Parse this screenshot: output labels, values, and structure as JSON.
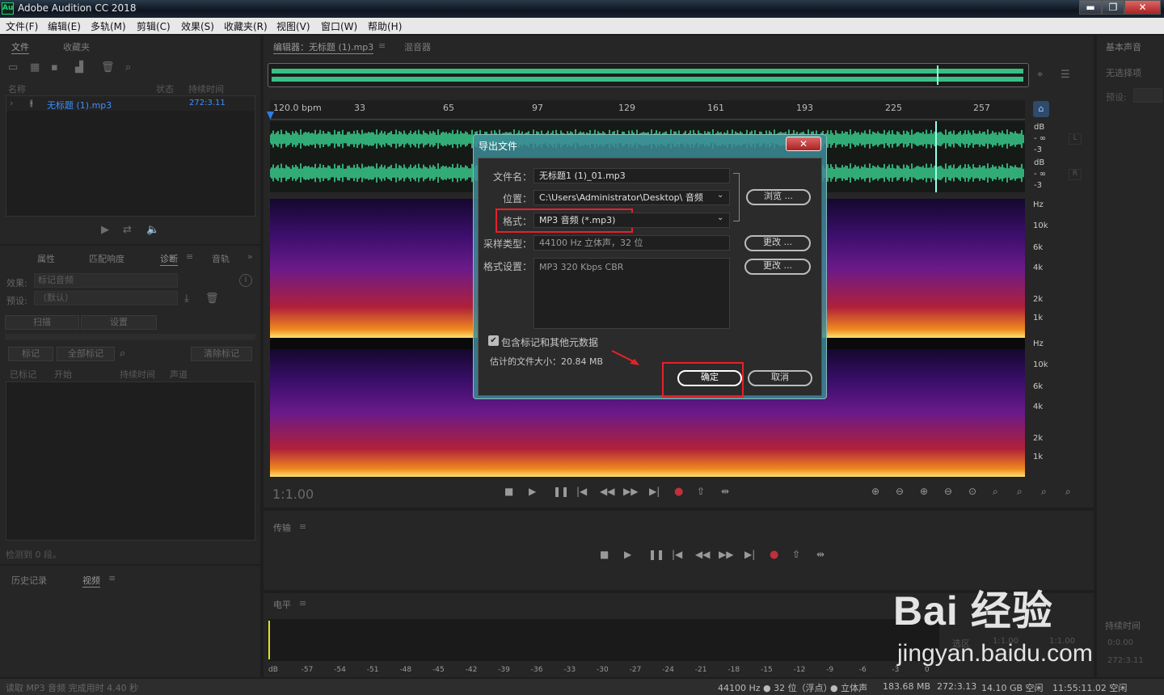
{
  "window": {
    "app_logo": "Au",
    "title": "Adobe Audition CC 2018",
    "minimize_icon": "minimize-icon",
    "restore_icon": "restore-icon",
    "close_icon": "close-icon"
  },
  "menu": [
    "文件(F)",
    "编辑(E)",
    "多轨(M)",
    "剪辑(C)",
    "效果(S)",
    "收藏夹(R)",
    "视图(V)",
    "窗口(W)",
    "帮助(H)"
  ],
  "files_panel": {
    "tabs": [
      "文件",
      "收藏夹"
    ],
    "columns": [
      "名称",
      "状态",
      "持续时间"
    ],
    "file": {
      "name": "无标题 (1).mp3",
      "duration": "272:3.11"
    }
  },
  "diag_panel": {
    "tabs": [
      "属性",
      "匹配响度",
      "诊断",
      "音轨"
    ],
    "effect_label": "效果:",
    "effect_value": "标记音频",
    "preset_label": "预设:",
    "preset_value": "（默认）",
    "scan": "扫描",
    "settings": "设置",
    "mark": "标记",
    "mark_all": "全部标记",
    "clear_marks": "清除标记",
    "list_columns": [
      "已标记",
      "开始",
      "持续时间",
      "声道"
    ],
    "detected": "检测到 0 段。"
  },
  "history_panel": {
    "tabs": [
      "历史记录",
      "视频"
    ]
  },
  "editor": {
    "tabs": [
      "编辑器：无标题 (1).mp3",
      "混音器"
    ],
    "bpm": "120.0 bpm",
    "ruler": [
      "33",
      "65",
      "97",
      "129",
      "161",
      "193",
      "225",
      "257"
    ],
    "db_labels": [
      "dB",
      "- ∞",
      "-3",
      "dB",
      "- ∞",
      "-3"
    ],
    "hz_labels_1": [
      "Hz",
      "10k",
      "6k",
      "4k",
      "2k",
      "1k"
    ],
    "hz_labels_2": [
      "Hz",
      "10k",
      "6k",
      "4k",
      "2k",
      "1k"
    ],
    "channels": [
      "L",
      "R"
    ],
    "time": "1:1.00"
  },
  "transport_panel": {
    "title": "传输"
  },
  "level_panel": {
    "title": "电平",
    "scale": [
      "dB",
      "-57",
      "-54",
      "-51",
      "-48",
      "-45",
      "-42",
      "-39",
      "-36",
      "-33",
      "-30",
      "-27",
      "-24",
      "-21",
      "-18",
      "-15",
      "-12",
      "-9",
      "-6",
      "-3",
      "0"
    ]
  },
  "right_panel": {
    "tab": "基本声音",
    "no_selection": "无选择项",
    "preset": "预设:",
    "sel_label": "选区",
    "sel_start": "1:1.00",
    "sel_end": "1:1.00",
    "duration_label": "持续时间",
    "dur1": "0:0.00",
    "dur2": "272:3.11"
  },
  "dialog": {
    "title": "导出文件",
    "filename_label": "文件名：",
    "filename_value": "无标题1 (1)_01.mp3",
    "location_label": "位置：",
    "location_value": "C:\\Users\\Administrator\\Desktop\\ 音频",
    "browse": "浏览 ...",
    "format_label": "格式：",
    "format_value": "MP3 音频 (*.mp3)",
    "sample_label": "采样类型：",
    "sample_value": "44100 Hz 立体声，32 位",
    "change1": "更改 ...",
    "format_settings_label": "格式设置：",
    "format_settings_value": "MP3 320 Kbps CBR",
    "change2": "更改 ...",
    "include_markers": "包含标记和其他元数据",
    "est_size": "估计的文件大小：20.84 MB",
    "ok": "确定",
    "cancel": "取消"
  },
  "status_bar": {
    "left": "读取 MP3 音频 完成用时 4.40 秒",
    "rate": "44100 Hz ● 32 位（浮点）",
    "channels": "● 立体声",
    "size": "183.68 MB",
    "duration": "272:3.13",
    "free": "14.10 GB 空闲",
    "time": "11:55:11.02 空闲"
  },
  "watermark": {
    "line1": "Bai 经验",
    "line2": "jingyan.baidu.com"
  },
  "colors": {
    "waveform": "#3ddc97",
    "accent": "#2f7de1",
    "highlight": "#e8202a",
    "dialog_border": "#3c8c96"
  }
}
